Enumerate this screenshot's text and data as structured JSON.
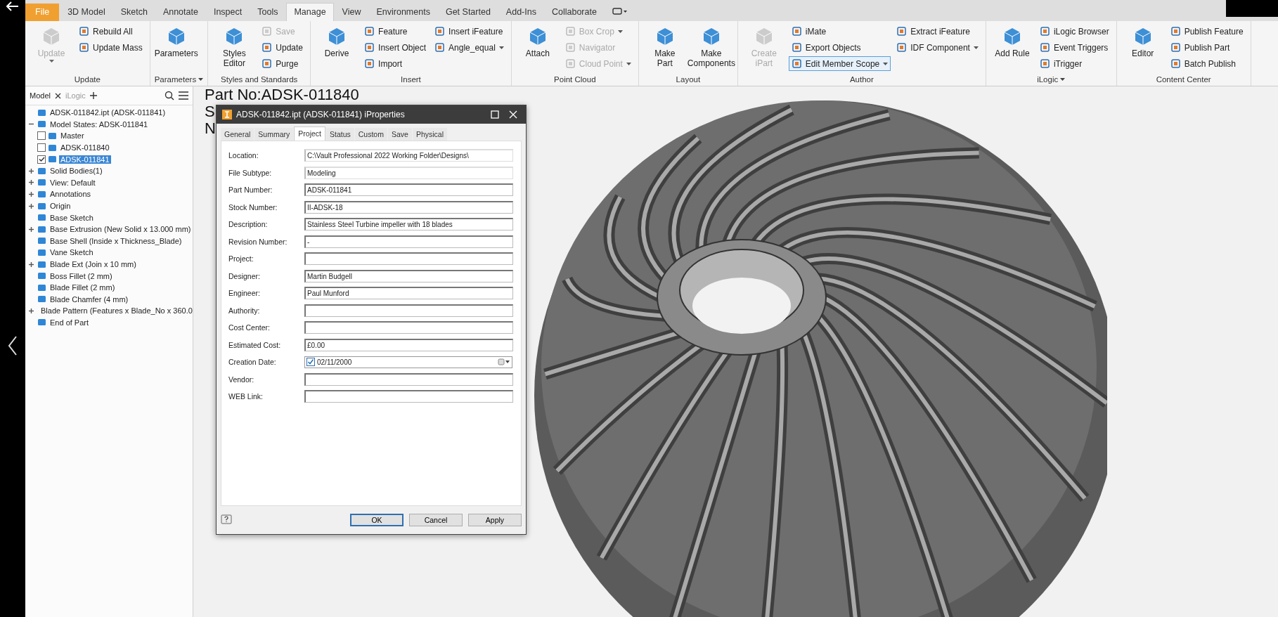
{
  "ribbon": {
    "tabs": [
      {
        "label": "File",
        "kind": "file",
        "selected": false
      },
      {
        "label": "3D Model",
        "kind": "tab",
        "selected": false
      },
      {
        "label": "Sketch",
        "kind": "tab",
        "selected": false
      },
      {
        "label": "Annotate",
        "kind": "tab",
        "selected": false
      },
      {
        "label": "Inspect",
        "kind": "tab",
        "selected": false
      },
      {
        "label": "Tools",
        "kind": "tab",
        "selected": false
      },
      {
        "label": "Manage",
        "kind": "tab",
        "selected": true
      },
      {
        "label": "View",
        "kind": "tab",
        "selected": false
      },
      {
        "label": "Environments",
        "kind": "tab",
        "selected": false
      },
      {
        "label": "Get Started",
        "kind": "tab",
        "selected": false
      },
      {
        "label": "Add-Ins",
        "kind": "tab",
        "selected": false
      },
      {
        "label": "Collaborate",
        "kind": "tab",
        "selected": false
      }
    ],
    "groups": [
      {
        "title": "Update",
        "menu": false,
        "items": [
          {
            "label": "Update",
            "kind": "large",
            "disabled": true,
            "dropdown": true,
            "focused": false
          },
          {
            "label": "Rebuild All",
            "kind": "small",
            "disabled": false,
            "dropdown": false,
            "focused": false
          },
          {
            "label": "Update Mass",
            "kind": "small",
            "disabled": false,
            "dropdown": false,
            "focused": false
          }
        ]
      },
      {
        "title": "Parameters",
        "menu": true,
        "items": [
          {
            "label": "Parameters",
            "kind": "large",
            "disabled": false,
            "dropdown": false,
            "focused": false
          }
        ]
      },
      {
        "title": "Styles and Standards",
        "menu": false,
        "items": [
          {
            "label": "Styles Editor",
            "kind": "large",
            "disabled": false,
            "dropdown": false,
            "focused": false
          },
          {
            "label": "Save",
            "kind": "small",
            "disabled": true,
            "dropdown": false,
            "focused": false
          },
          {
            "label": "Update",
            "kind": "small",
            "disabled": false,
            "dropdown": false,
            "focused": false
          },
          {
            "label": "Purge",
            "kind": "small",
            "disabled": false,
            "dropdown": false,
            "focused": false
          }
        ]
      },
      {
        "title": "Insert",
        "menu": false,
        "items": [
          {
            "label": "Derive",
            "kind": "large",
            "disabled": false,
            "dropdown": false,
            "focused": false
          },
          {
            "label": "Feature",
            "kind": "small",
            "disabled": false,
            "dropdown": false,
            "focused": false
          },
          {
            "label": "Insert Object",
            "kind": "small",
            "disabled": false,
            "dropdown": false,
            "focused": false
          },
          {
            "label": "Import",
            "kind": "small",
            "disabled": false,
            "dropdown": false,
            "focused": false
          },
          {
            "label": "Insert iFeature",
            "kind": "small",
            "disabled": false,
            "dropdown": false,
            "focused": false
          },
          {
            "label": "Angle_equal",
            "kind": "small",
            "disabled": false,
            "dropdown": true,
            "focused": false
          }
        ]
      },
      {
        "title": "Point Cloud",
        "menu": false,
        "items": [
          {
            "label": "Attach",
            "kind": "large",
            "disabled": false,
            "dropdown": false,
            "focused": false
          },
          {
            "label": "Box Crop",
            "kind": "small",
            "disabled": true,
            "dropdown": true,
            "focused": false
          },
          {
            "label": "Navigator",
            "kind": "small",
            "disabled": true,
            "dropdown": false,
            "focused": false
          },
          {
            "label": "Cloud Point",
            "kind": "small",
            "disabled": true,
            "dropdown": true,
            "focused": false
          }
        ]
      },
      {
        "title": "Layout",
        "menu": false,
        "items": [
          {
            "label": "Make Part",
            "kind": "large",
            "disabled": false,
            "dropdown": false,
            "focused": false
          },
          {
            "label": "Make Components",
            "kind": "large",
            "disabled": false,
            "dropdown": false,
            "focused": false
          }
        ]
      },
      {
        "title": "Author",
        "menu": false,
        "items": [
          {
            "label": "Create iPart",
            "kind": "large",
            "disabled": true,
            "dropdown": false,
            "focused": false
          },
          {
            "label": "iMate",
            "kind": "small",
            "disabled": false,
            "dropdown": false,
            "focused": false
          },
          {
            "label": "Export Objects",
            "kind": "small",
            "disabled": false,
            "dropdown": false,
            "focused": false
          },
          {
            "label": "Edit Member Scope",
            "kind": "small",
            "disabled": false,
            "dropdown": true,
            "focused": true
          },
          {
            "label": "Extract iFeature",
            "kind": "small",
            "disabled": false,
            "dropdown": false,
            "focused": false
          },
          {
            "label": "IDF Component",
            "kind": "small",
            "disabled": false,
            "dropdown": true,
            "focused": false
          }
        ]
      },
      {
        "title": "iLogic",
        "menu": true,
        "items": [
          {
            "label": "Add Rule",
            "kind": "large",
            "disabled": false,
            "dropdown": false,
            "focused": false
          },
          {
            "label": "iLogic Browser",
            "kind": "small",
            "disabled": false,
            "dropdown": false,
            "focused": false
          },
          {
            "label": "Event Triggers",
            "kind": "small",
            "disabled": false,
            "dropdown": false,
            "focused": false
          },
          {
            "label": "iTrigger",
            "kind": "small",
            "disabled": false,
            "dropdown": false,
            "focused": false
          }
        ]
      },
      {
        "title": "Content Center",
        "menu": false,
        "items": [
          {
            "label": "Editor",
            "kind": "large",
            "disabled": false,
            "dropdown": false,
            "focused": false
          },
          {
            "label": "Publish Feature",
            "kind": "small",
            "disabled": false,
            "dropdown": false,
            "focused": false
          },
          {
            "label": "Publish Part",
            "kind": "small",
            "disabled": false,
            "dropdown": false,
            "focused": false
          },
          {
            "label": "Batch Publish",
            "kind": "small",
            "disabled": false,
            "dropdown": false,
            "focused": false
          }
        ]
      }
    ]
  },
  "browser": {
    "tabs": [
      {
        "label": "Model",
        "selected": true
      },
      {
        "label": "iLogic",
        "selected": false
      }
    ],
    "tree": [
      {
        "label": "ADSK-011842.ipt (ADSK-011841)",
        "selected": false,
        "children": [
          {
            "label": "Model States: ADSK-011841",
            "selected": false,
            "expanded": true,
            "children": [
              {
                "label": "Master",
                "selected": false,
                "checked": false
              },
              {
                "label": "ADSK-011840",
                "selected": false,
                "checked": false
              },
              {
                "label": "ADSK-011841",
                "selected": true,
                "checked": true
              }
            ]
          },
          {
            "label": "Solid Bodies(1)",
            "selected": false,
            "expanded": false
          },
          {
            "label": "View: Default",
            "selected": false,
            "expanded": false
          },
          {
            "label": "Annotations",
            "selected": false,
            "expanded": false
          },
          {
            "label": "Origin",
            "selected": false,
            "expanded": false
          },
          {
            "label": "Base Sketch",
            "selected": false
          },
          {
            "label": "Base Extrusion (New Solid x 13.000 mm)",
            "selected": false,
            "expanded": false
          },
          {
            "label": "Base Shell (Inside x Thickness_Blade)",
            "selected": false
          },
          {
            "label": "Vane Sketch",
            "selected": false
          },
          {
            "label": "Blade Ext (Join x 10 mm)",
            "selected": false,
            "expanded": false
          },
          {
            "label": "Boss Fillet (2 mm)",
            "selected": false
          },
          {
            "label": "Blade Fillet (2 mm)",
            "selected": false
          },
          {
            "label": "Blade Chamfer (4 mm)",
            "selected": false
          },
          {
            "label": "Blade Pattern (Features x Blade_No x 360.0",
            "selected": false,
            "expanded": false
          },
          {
            "label": "End of Part",
            "selected": false
          }
        ]
      }
    ]
  },
  "viewport": {
    "lines": [
      "Part No:ADSK-011840",
      "S",
      "N"
    ]
  },
  "dialog": {
    "title": "ADSK-011842.ipt (ADSK-011841) iProperties",
    "tabs": [
      {
        "label": "General",
        "selected": false
      },
      {
        "label": "Summary",
        "selected": false
      },
      {
        "label": "Project",
        "selected": true
      },
      {
        "label": "Status",
        "selected": false
      },
      {
        "label": "Custom",
        "selected": false
      },
      {
        "label": "Save",
        "selected": false
      },
      {
        "label": "Physical",
        "selected": false
      }
    ],
    "fields": [
      {
        "label": "Location:",
        "kind": "readonly",
        "value": "C:\\Vault Professional 2022 Working Folder\\Designs\\"
      },
      {
        "label": "File Subtype:",
        "kind": "readonly",
        "value": "Modeling"
      },
      {
        "label": "Part Number:",
        "kind": "text",
        "value": "ADSK-011841"
      },
      {
        "label": "Stock Number:",
        "kind": "text",
        "value": "II-ADSK-18"
      },
      {
        "label": "Description:",
        "kind": "text",
        "value": "Stainless Steel Turbine impeller with 18 blades"
      },
      {
        "label": "Revision Number:",
        "kind": "text",
        "value": "-"
      },
      {
        "label": "Project:",
        "kind": "text"
      },
      {
        "label": "Designer:",
        "kind": "text",
        "value": "Martin Budgell"
      },
      {
        "label": "Engineer:",
        "kind": "text",
        "value": "Paul Munford"
      },
      {
        "label": "Authority:",
        "kind": "text"
      },
      {
        "label": "Cost Center:",
        "kind": "text"
      },
      {
        "label": "Estimated Cost:",
        "kind": "text",
        "value": "£0.00"
      },
      {
        "label": "Creation Date:",
        "kind": "date",
        "value": "02/11/2000",
        "checked": true
      },
      {
        "label": "Vendor:",
        "kind": "text"
      },
      {
        "label": "WEB Link:",
        "kind": "text"
      }
    ],
    "buttons": [
      {
        "label": "OK",
        "default": true
      },
      {
        "label": "Cancel",
        "default": false
      },
      {
        "label": "Apply",
        "default": false
      }
    ]
  }
}
